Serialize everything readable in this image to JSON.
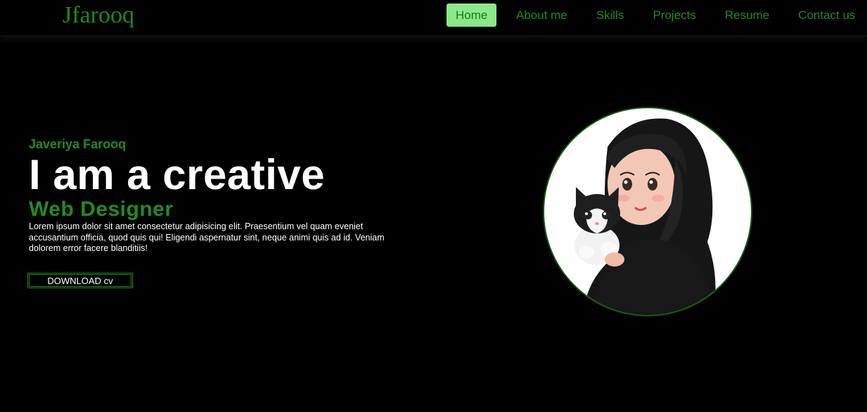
{
  "header": {
    "logo": "Jfarooq",
    "nav": [
      {
        "label": "Home",
        "active": true
      },
      {
        "label": "About me"
      },
      {
        "label": "Skills"
      },
      {
        "label": "Projects"
      },
      {
        "label": "Resume"
      },
      {
        "label": "Contact us"
      }
    ]
  },
  "hero": {
    "subtitle": "Javeriya Farooq",
    "headline": "I am a creative",
    "role": "Web Designer",
    "description": "Lorem ipsum dolor sit amet consectetur adipisicing elit. Praesentium vel quam eveniet accusantium officia, quod quis qui! Eligendi aspernatur sint, neque animi quis ad id. Veniam dolorem error facere blanditiis!",
    "download_label": "DOWNLOAD cv"
  },
  "colors": {
    "background": "#000000",
    "accent": "#228b22",
    "active_nav_bg": "#8be88b",
    "text": "#ffffff"
  }
}
